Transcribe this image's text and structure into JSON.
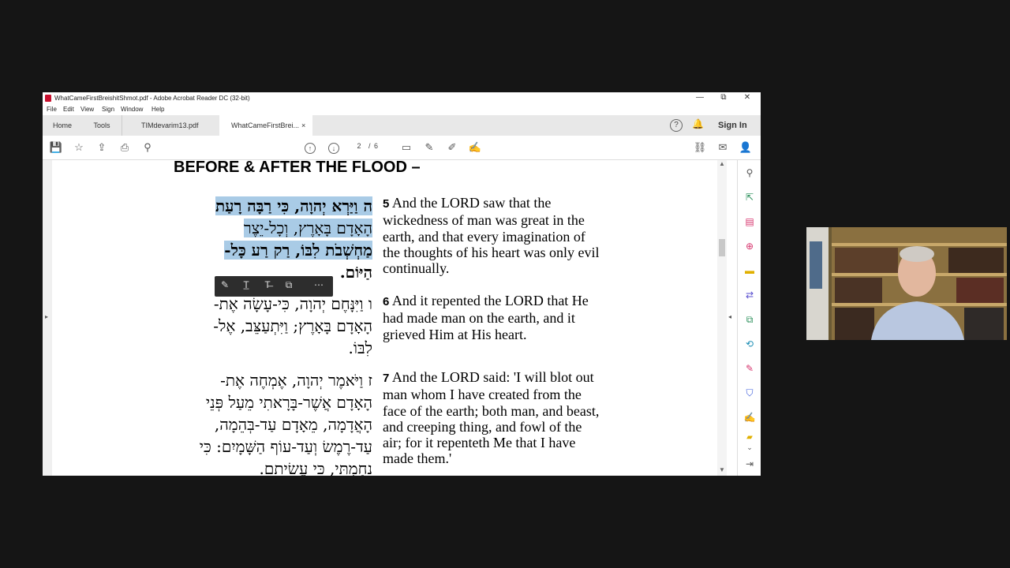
{
  "window": {
    "title": "WhatCameFirstBreishitShmot.pdf - Adobe Acrobat Reader DC (32-bit)",
    "controls": {
      "minimize": "—",
      "restore": "⧉",
      "close": "✕"
    }
  },
  "menu": [
    "File",
    "Edit",
    "View",
    "Sign",
    "Window",
    "Help"
  ],
  "tabs": {
    "home": "Home",
    "tools": "Tools",
    "doc1": "TIMdevarim13.pdf",
    "doc2": "WhatCameFirstBrei...",
    "close": "×",
    "sign_in": "Sign In"
  },
  "toolbar": {
    "page_current": "2",
    "page_sep": "/",
    "page_total": "6"
  },
  "document": {
    "heading": "BEFORE & AFTER THE FLOOD –",
    "verses": [
      {
        "heb_lines": [
          "ה  וַיַּרְא יְהוָה, כִּי רַבָּה רָעַת",
          "הָאָדָם בָּאָרֶץ, וְכָל-יֵצֶר",
          "מַחְשְׁבֹת לִבּוֹ, רַק רַע כָּל-",
          "הַיּוֹם."
        ],
        "num": "5",
        "eng_lines": [
          "And the LORD saw that the",
          "wickedness of man was great in the",
          "earth, and that every imagination of",
          "the thoughts of his heart was only evil",
          "continually."
        ]
      },
      {
        "heb_lines": [
          "ו  וַיִּנָּחֶם יְהוָה, כִּי-עָשָׂה אֶת-",
          "הָאָדָם בָּאָרֶץ; וַיִּתְעַצֵּב, אֶל-",
          "לִבּוֹ."
        ],
        "num": "6",
        "eng_lines": [
          "And it repented the LORD that He",
          "had made man on the earth, and it",
          "grieved Him at His heart."
        ]
      },
      {
        "heb_lines": [
          "ז  וַיֹּאמֶר יְהוָה, אֶמְחֶה אֶת-",
          "הָאָדָם אֲשֶׁר-בָּרָאתִי מֵעַל פְּנֵי",
          "הָאֲדָמָה, מֵאָדָם עַד-בְּהֵמָה,",
          "עַד-רֶמֶשׂ וְעַד-עוֹף הַשָּׁמָיִם:  כִּי",
          "נִחַמְתִּי, כִּי עֲשִׂיתִם."
        ],
        "num": "7",
        "eng_lines": [
          "And the LORD said: 'I will blot out",
          "man whom I have created from the",
          "face of the earth; both man, and beast,",
          "and creeping thing, and fowl of the",
          "air; for it repenteth Me that I have",
          "made them.'"
        ]
      }
    ]
  },
  "colors": {
    "highlight": "#a9cbe6",
    "pdf_red": "#c8102e"
  }
}
